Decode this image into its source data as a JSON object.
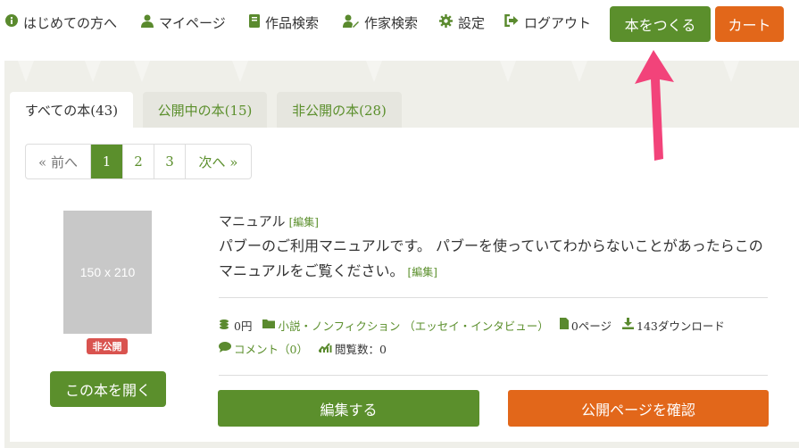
{
  "nav": {
    "beginners": "はじめての方へ",
    "mypage": "マイページ",
    "book_search": "作品検索",
    "author_search": "作家検索",
    "settings": "設定",
    "logout": "ログアウト",
    "make_book": "本をつくる",
    "cart": "カート"
  },
  "tabs": {
    "all": "すべての本(43)",
    "public": "公開中の本(15)",
    "private": "非公開の本(28)"
  },
  "pagination": {
    "prev": "« 前へ",
    "pages": [
      "1",
      "2",
      "3"
    ],
    "next": "次へ »",
    "current": "1"
  },
  "book": {
    "placeholder": "150 x 210",
    "status": "非公開",
    "open_button": "この本を開く",
    "title": "マニュアル",
    "edit_link": "[編集]",
    "description": "パブーのご利用マニュアルです。 パブーを使っていてわからないことがあったらこのマニュアルをご覧ください。",
    "description_edit_link": "[編集]",
    "price": "0円",
    "category": "小説・ノンフィクション （エッセイ・インタビュー）",
    "pages": "0ページ",
    "downloads": "143ダウンロード",
    "comments": "コメント（0）",
    "views": "閲覧数：0",
    "edit_button": "編集する",
    "public_page_button": "公開ページを確認"
  },
  "colors": {
    "green": "#5b8f2c",
    "orange": "#e2671a",
    "arrow": "#f2437a",
    "badge": "#d9534f"
  }
}
